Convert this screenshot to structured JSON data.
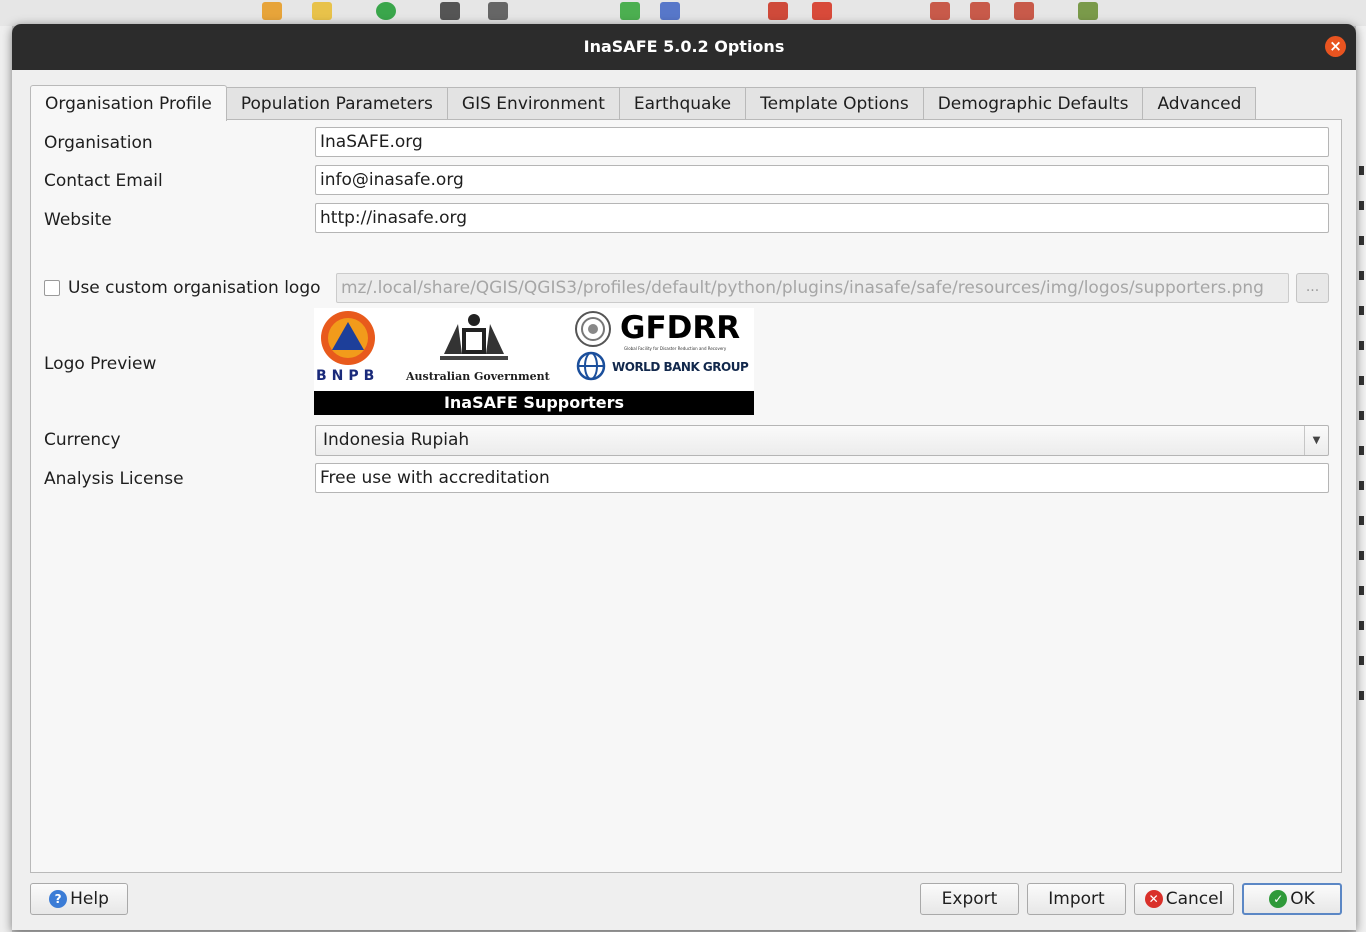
{
  "window": {
    "title": "InaSAFE 5.0.2 Options"
  },
  "tabs": [
    {
      "label": "Organisation Profile",
      "active": true
    },
    {
      "label": "Population Parameters"
    },
    {
      "label": "GIS Environment"
    },
    {
      "label": "Earthquake"
    },
    {
      "label": "Template Options"
    },
    {
      "label": "Demographic Defaults"
    },
    {
      "label": "Advanced"
    }
  ],
  "form": {
    "organisation": {
      "label": "Organisation",
      "value": "InaSAFE.org"
    },
    "contact_email": {
      "label": "Contact Email",
      "value": "info@inasafe.org"
    },
    "website": {
      "label": "Website",
      "value": "http://inasafe.org"
    },
    "custom_logo": {
      "label": "Use custom organisation logo",
      "checked": false,
      "path": "mz/.local/share/QGIS/QGIS3/profiles/default/python/plugins/inasafe/safe/resources/img/logos/supporters.png",
      "browse_label": "..."
    },
    "logo_preview": {
      "label": "Logo Preview",
      "bnpb": "BNPB",
      "australian_gov": "Australian Government",
      "gfdrr": "GFDRR",
      "gfdrr_sub": "Global Facility for Disaster Reduction and Recovery",
      "world_bank": "WORLD BANK GROUP",
      "band_text": "InaSAFE Supporters"
    },
    "currency": {
      "label": "Currency",
      "selected": "Indonesia Rupiah"
    },
    "analysis_license": {
      "label": "Analysis License",
      "value": "Free use with accreditation"
    }
  },
  "buttons": {
    "help": "Help",
    "export": "Export",
    "import": "Import",
    "cancel": "Cancel",
    "ok": "OK"
  },
  "icons": {
    "close": "close-icon",
    "help": "help-icon",
    "cancel": "cancel-icon",
    "ok": "check-icon"
  },
  "colors": {
    "titlebar": "#2c2c2c",
    "close": "#e95420",
    "help_icon": "#3b7cd6",
    "cancel_icon": "#d9302a",
    "ok_icon": "#2f9a3a",
    "default_border": "#5b87c5"
  }
}
